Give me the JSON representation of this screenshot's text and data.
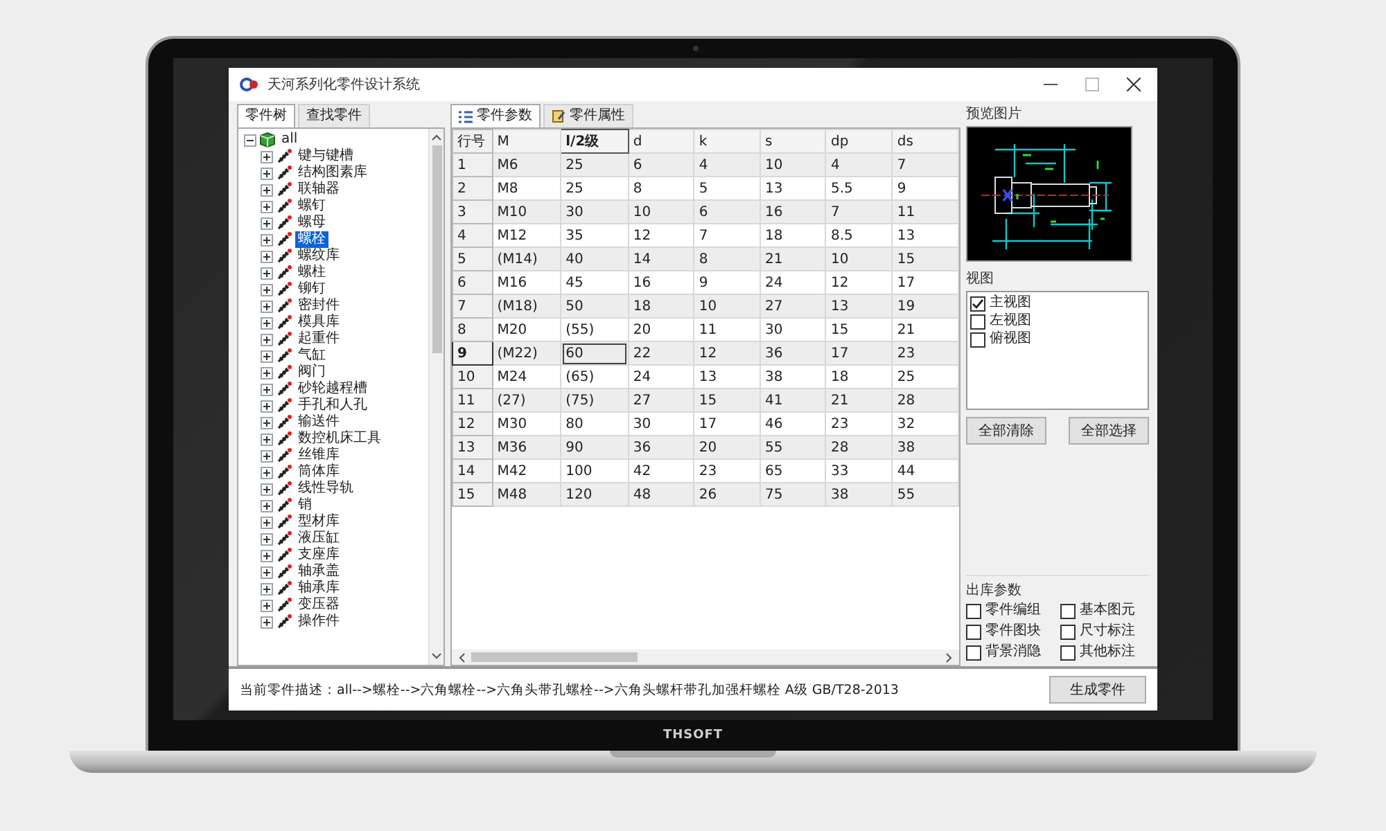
{
  "device": {
    "brand": "THSOFT"
  },
  "window": {
    "title": "天河系列化零件设计系统"
  },
  "left_tabs": [
    {
      "label": "零件树",
      "selected": true
    },
    {
      "label": "查找零件",
      "selected": false
    }
  ],
  "tree": [
    {
      "label": "all",
      "expanded": true,
      "selected": false,
      "children": [
        {
          "label": "键与键槽",
          "expanded": false,
          "selected": false
        },
        {
          "label": "结构图素库",
          "expanded": false,
          "selected": false
        },
        {
          "label": "联轴器",
          "expanded": false,
          "selected": false
        },
        {
          "label": "螺钉",
          "expanded": false,
          "selected": false
        },
        {
          "label": "螺母",
          "expanded": false,
          "selected": false
        },
        {
          "label": "螺栓",
          "expanded": false,
          "selected": true
        },
        {
          "label": "螺纹库",
          "expanded": false,
          "selected": false
        },
        {
          "label": "螺柱",
          "expanded": false,
          "selected": false
        },
        {
          "label": "铆钉",
          "expanded": false,
          "selected": false
        },
        {
          "label": "密封件",
          "expanded": false,
          "selected": false
        },
        {
          "label": "模具库",
          "expanded": false,
          "selected": false
        },
        {
          "label": "起重件",
          "expanded": false,
          "selected": false
        },
        {
          "label": "气缸",
          "expanded": false,
          "selected": false
        },
        {
          "label": "阀门",
          "expanded": false,
          "selected": false
        },
        {
          "label": "砂轮越程槽",
          "expanded": false,
          "selected": false
        },
        {
          "label": "手孔和人孔",
          "expanded": false,
          "selected": false
        },
        {
          "label": "输送件",
          "expanded": false,
          "selected": false
        },
        {
          "label": "数控机床工具",
          "expanded": false,
          "selected": false
        },
        {
          "label": "丝锥库",
          "expanded": false,
          "selected": false
        },
        {
          "label": "筒体库",
          "expanded": false,
          "selected": false
        },
        {
          "label": "线性导轨",
          "expanded": false,
          "selected": false
        },
        {
          "label": "销",
          "expanded": false,
          "selected": false
        },
        {
          "label": "型材库",
          "expanded": false,
          "selected": false
        },
        {
          "label": "液压缸",
          "expanded": false,
          "selected": false
        },
        {
          "label": "支座库",
          "expanded": false,
          "selected": false
        },
        {
          "label": "轴承盖",
          "expanded": false,
          "selected": false
        },
        {
          "label": "轴承库",
          "expanded": false,
          "selected": false
        },
        {
          "label": "变压器",
          "expanded": false,
          "selected": false
        },
        {
          "label": "操作件",
          "expanded": false,
          "selected": false
        }
      ]
    }
  ],
  "center_tabs": [
    {
      "label": "零件参数",
      "selected": true
    },
    {
      "label": "零件属性",
      "selected": false
    }
  ],
  "table": {
    "row_header": "行号",
    "columns": [
      {
        "label": "M",
        "selected": false
      },
      {
        "label": "l/2级",
        "selected": true
      },
      {
        "label": "d",
        "selected": false
      },
      {
        "label": "k",
        "selected": false
      },
      {
        "label": "s",
        "selected": false
      },
      {
        "label": "dp",
        "selected": false
      },
      {
        "label": "ds",
        "selected": false
      }
    ],
    "rows": [
      {
        "number": "1",
        "selected": false,
        "cells": [
          "M6",
          "25",
          "6",
          "4",
          "10",
          "4",
          "7"
        ]
      },
      {
        "number": "2",
        "selected": false,
        "cells": [
          "M8",
          "25",
          "8",
          "5",
          "13",
          "5.5",
          "9"
        ]
      },
      {
        "number": "3",
        "selected": false,
        "cells": [
          "M10",
          "30",
          "10",
          "6",
          "16",
          "7",
          "11"
        ]
      },
      {
        "number": "4",
        "selected": false,
        "cells": [
          "M12",
          "35",
          "12",
          "7",
          "18",
          "8.5",
          "13"
        ]
      },
      {
        "number": "5",
        "selected": false,
        "cells": [
          "(M14)",
          "40",
          "14",
          "8",
          "21",
          "10",
          "15"
        ]
      },
      {
        "number": "6",
        "selected": false,
        "cells": [
          "M16",
          "45",
          "16",
          "9",
          "24",
          "12",
          "17"
        ]
      },
      {
        "number": "7",
        "selected": false,
        "cells": [
          "(M18)",
          "50",
          "18",
          "10",
          "27",
          "13",
          "19"
        ]
      },
      {
        "number": "8",
        "selected": false,
        "cells": [
          "M20",
          "(55)",
          "20",
          "11",
          "30",
          "15",
          "21"
        ]
      },
      {
        "number": "9",
        "selected": true,
        "cells": [
          "(M22)",
          "60",
          "22",
          "12",
          "36",
          "17",
          "23"
        ]
      },
      {
        "number": "10",
        "selected": false,
        "cells": [
          "M24",
          "(65)",
          "24",
          "13",
          "38",
          "18",
          "25"
        ]
      },
      {
        "number": "11",
        "selected": false,
        "cells": [
          "(27)",
          "(75)",
          "27",
          "15",
          "41",
          "21",
          "28"
        ]
      },
      {
        "number": "12",
        "selected": false,
        "cells": [
          "M30",
          "80",
          "30",
          "17",
          "46",
          "23",
          "32"
        ]
      },
      {
        "number": "13",
        "selected": false,
        "cells": [
          "M36",
          "90",
          "36",
          "20",
          "55",
          "28",
          "38"
        ]
      },
      {
        "number": "14",
        "selected": false,
        "cells": [
          "M42",
          "100",
          "42",
          "23",
          "65",
          "33",
          "44"
        ]
      },
      {
        "number": "15",
        "selected": false,
        "cells": [
          "M48",
          "120",
          "48",
          "26",
          "75",
          "38",
          "55"
        ]
      }
    ]
  },
  "preview": {
    "title": "预览图片"
  },
  "views": {
    "title": "视图",
    "items": [
      {
        "label": "主视图",
        "checked": true
      },
      {
        "label": "左视图",
        "checked": false
      },
      {
        "label": "俯视图",
        "checked": false
      }
    ],
    "buttons": [
      "全部清除",
      "全部选择"
    ]
  },
  "output_params": {
    "title": "出库参数",
    "items": [
      {
        "label": "零件编组",
        "checked": false
      },
      {
        "label": "基本图元",
        "checked": false
      },
      {
        "label": "零件图块",
        "checked": false
      },
      {
        "label": "尺寸标注",
        "checked": false
      },
      {
        "label": "背景消隐",
        "checked": false
      },
      {
        "label": "其他标注",
        "checked": false
      }
    ]
  },
  "status_bar": {
    "description": "当前零件描述：all-->螺栓-->六角螺栓-->六角头带孔螺栓-->六角头螺杆带孔加强杆螺栓 A级 GB/T28-2013",
    "button": "生成零件"
  }
}
